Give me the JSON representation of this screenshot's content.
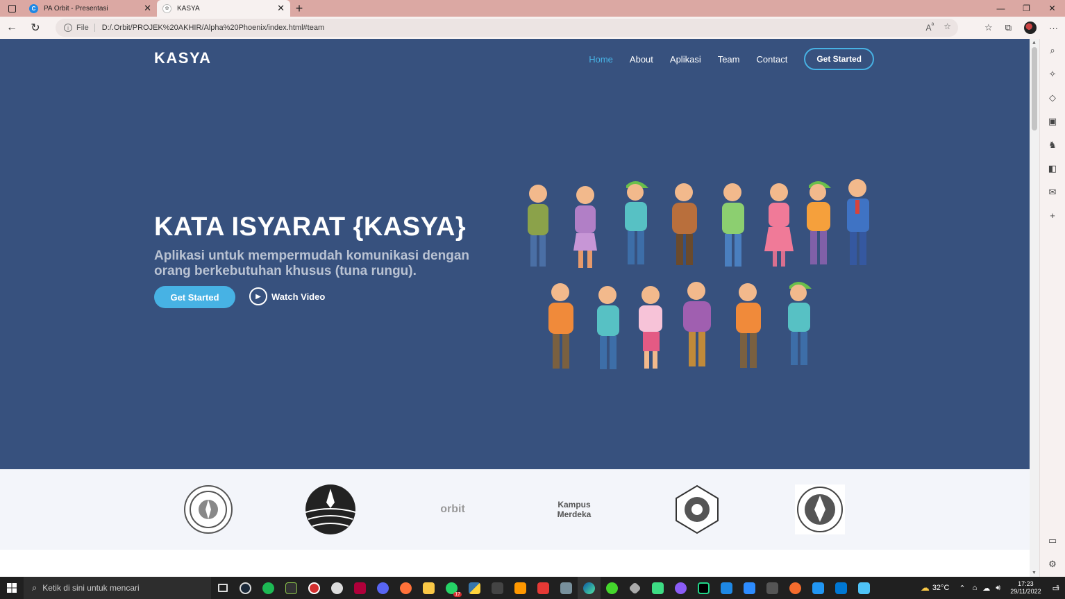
{
  "browser": {
    "tabs": [
      {
        "title": "PA Orbit - Presentasi",
        "active": false
      },
      {
        "title": "KASYA",
        "active": true
      }
    ],
    "address": {
      "scheme_label": "File",
      "url": "D:/.Orbit/PROJEK%20AKHIR/Alpha%20Phoenix/index.html#team"
    }
  },
  "site": {
    "logo": "KASYA",
    "nav": [
      {
        "label": "Home",
        "active": true
      },
      {
        "label": "About",
        "active": false
      },
      {
        "label": "Aplikasi",
        "active": false
      },
      {
        "label": "Team",
        "active": false
      },
      {
        "label": "Contact",
        "active": false
      }
    ],
    "nav_cta": "Get Started",
    "hero": {
      "title": "KATA ISYARAT {KASYA}",
      "subtitle": "Aplikasi untuk mempermudah komunikasi dengan orang berkebutuhan khusus (tuna rungu).",
      "primary_button": "Get Started",
      "video_button": "Watch Video"
    },
    "clients": [
      {
        "name": "university-seal-logo"
      },
      {
        "name": "kemdikbud-logo"
      },
      {
        "name": "orbit-logo",
        "text": "orbit"
      },
      {
        "name": "kampus-merdeka-logo",
        "text": "Kampus Merdeka"
      },
      {
        "name": "university-emblem-logo"
      },
      {
        "name": "tut-wuri-handayani-logo"
      }
    ]
  },
  "taskbar": {
    "search_placeholder": "Ketik di sini untuk mencari",
    "weather": "32°C",
    "time": "17:23",
    "date": "29/11/2022",
    "notifications": "5",
    "whatsapp_badge": "17"
  },
  "colors": {
    "hero_bg": "#37517e",
    "accent": "#47b2e4",
    "clients_bg": "#f3f5fa",
    "titlebar": "#dba8a3"
  }
}
